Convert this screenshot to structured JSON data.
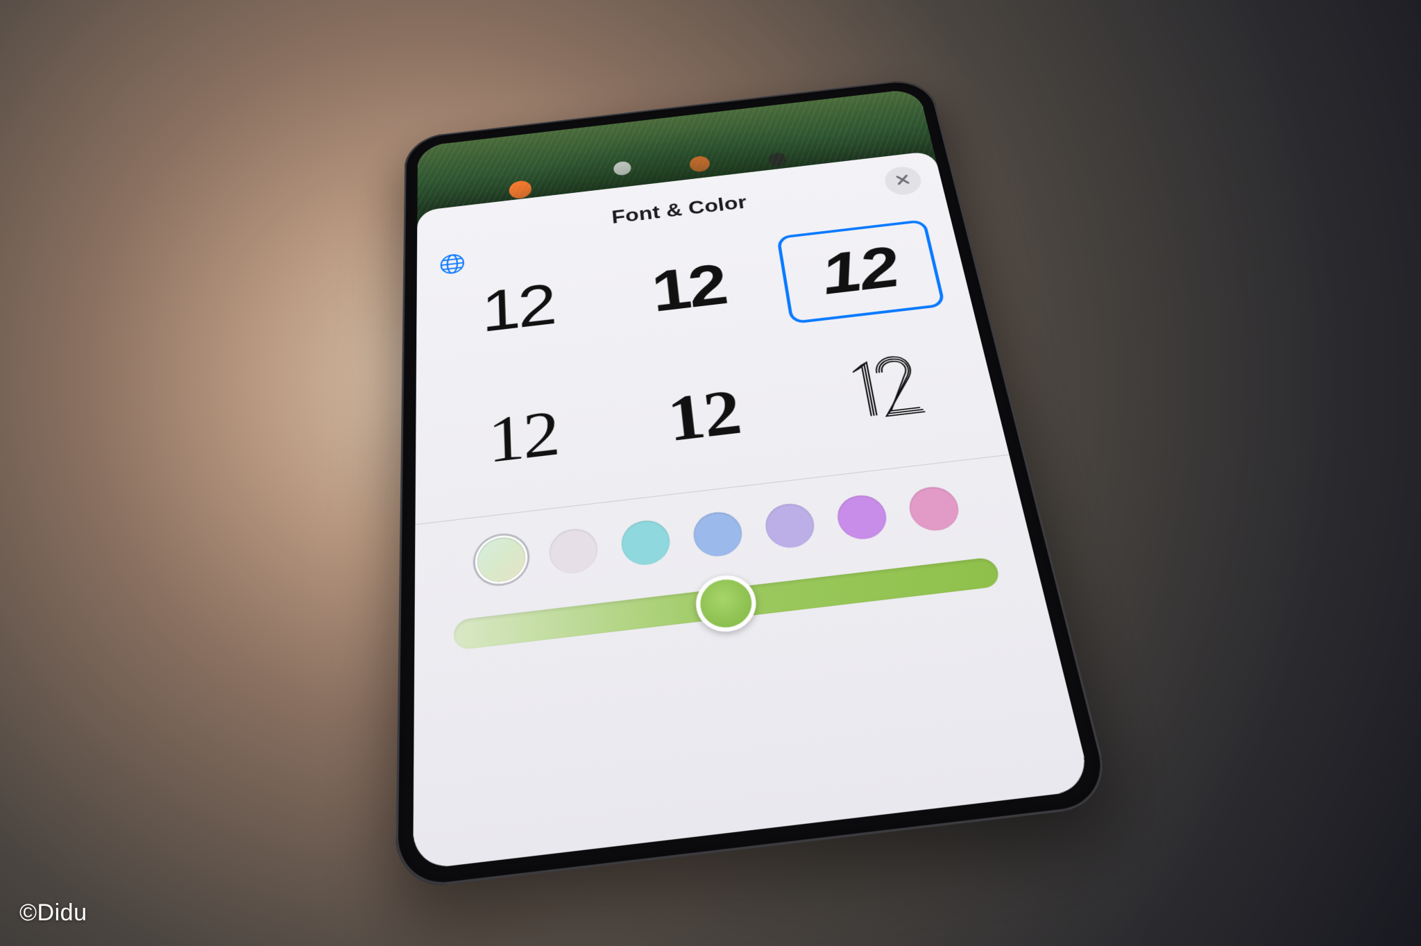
{
  "watermark": "©Didu",
  "sheet": {
    "title": "Font & Color",
    "close_icon": "close-icon",
    "globe_icon": "globe-icon"
  },
  "fonts": {
    "sample_text": "12",
    "options": [
      {
        "id": "sf-light",
        "selected": false
      },
      {
        "id": "sf-bold",
        "selected": false
      },
      {
        "id": "stencil",
        "selected": true
      },
      {
        "id": "serif-soft",
        "selected": false
      },
      {
        "id": "didot",
        "selected": false
      },
      {
        "id": "outline",
        "selected": false
      }
    ]
  },
  "colors": {
    "swatches": [
      {
        "hex_top": "#d6efe0",
        "hex_bot": "#d9e9c9",
        "gradient": true,
        "selected": true
      },
      {
        "hex": "#e7dfe8",
        "selected": false
      },
      {
        "hex": "#8fd9de",
        "selected": false
      },
      {
        "hex": "#9bb9ea",
        "selected": false
      },
      {
        "hex": "#bcafe8",
        "selected": false
      },
      {
        "hex": "#c88de8",
        "selected": false
      },
      {
        "hex": "#e29ac7",
        "selected": false
      }
    ]
  },
  "slider": {
    "min": 0,
    "max": 100,
    "value": 50,
    "track_accent": "#8fc04b",
    "thumb_color": "#93c556"
  }
}
